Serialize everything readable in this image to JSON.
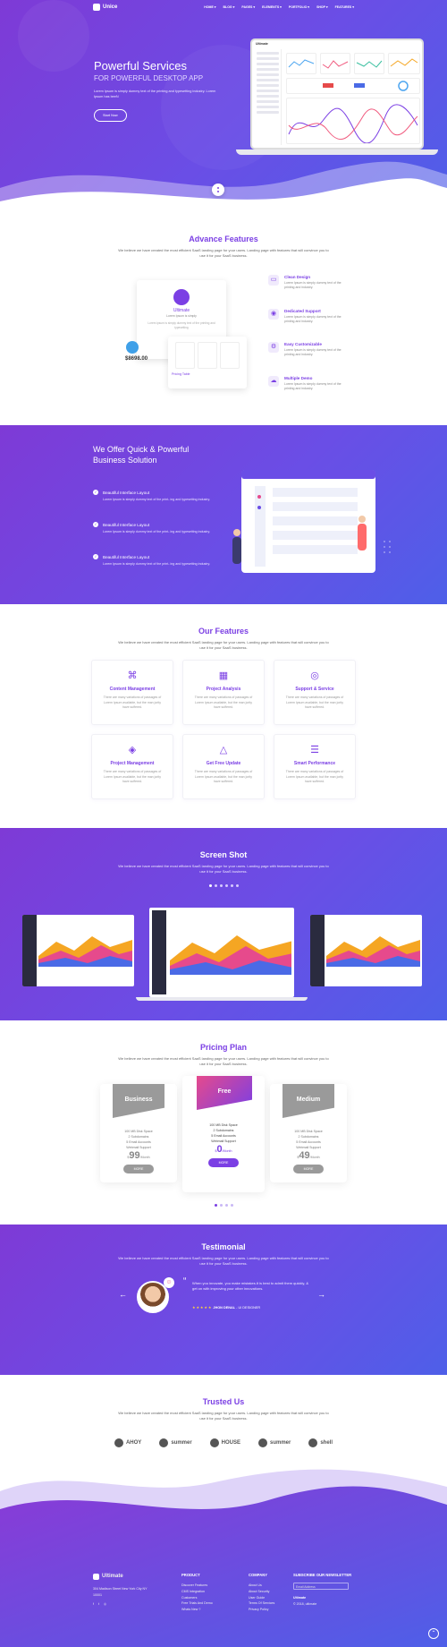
{
  "nav": {
    "brand": "Unice",
    "menu": [
      "HOME ▾",
      "BLOG ▾",
      "PAGES ▾",
      "ELEMENTS ▾",
      "PORTFOLIO ▾",
      "SHOP ▾",
      "FEATURES ▾"
    ]
  },
  "hero": {
    "title": "Powerful Services",
    "subtitle": "FOR POWERFUL DESKTOP APP",
    "text": "Lorem Ipsum is simply dummy text of the printing and typesetting industry. Lorem Ipsum has beeN",
    "button": "Start Now",
    "dash_brand": "Ultimate"
  },
  "advance": {
    "title": "Advance Features",
    "subtitle": "We believe we have created the most efficient SaaS landing page for your users. Landing page with features that will convince you to use it for your SaaS business.",
    "card_brand": "Ultimate",
    "card_tag": "Lorem Ipsum is simply",
    "card_desc": "Lorem ipsum is simply dummy text of the printing and typesetting",
    "stat": "$8698.00",
    "pricing_label": "Pricing Table",
    "items": [
      {
        "title": "Clean Design",
        "desc": "Lorem Ipsum is simply dummy text of the printing and industry."
      },
      {
        "title": "Dedicated Support",
        "desc": "Lorem Ipsum is simply dummy text of the printing and industry."
      },
      {
        "title": "Easy Customizable",
        "desc": "Lorem Ipsum is simply dummy text of the printing and industry."
      },
      {
        "title": "Multiple Demo",
        "desc": "Lorem Ipsum is simply dummy text of the printing and industry."
      }
    ]
  },
  "quick": {
    "title": "We Offer Quick & Powerful Business Solution",
    "items": [
      {
        "title": "Beautiful Interface Layout",
        "desc": "Lorem Ipsum is simply dummy text of the print- ing and typesetting industry."
      },
      {
        "title": "Beautiful Interface Layout",
        "desc": "Lorem Ipsum is simply dummy text of the print- ing and typesetting industry."
      },
      {
        "title": "Beautiful Interface Layout",
        "desc": "Lorem Ipsum is simply dummy text of the print- ing and typesetting industry."
      }
    ]
  },
  "features": {
    "title": "Our Features",
    "subtitle": "We believe we have created the most efficient SaaS landing page for your users. Landing page with features that will convince you to use it for your SaaS business.",
    "cards": [
      {
        "icon": "⌘",
        "title": "Content Management",
        "desc": "There are many variations of passages of Lorem Ipsum available, but the man jority have suffered."
      },
      {
        "icon": "▦",
        "title": "Project Analysis",
        "desc": "There are many variations of passages of Lorem Ipsum available, but the man jority have suffered."
      },
      {
        "icon": "◎",
        "title": "Support & Service",
        "desc": "There are many variations of passages of Lorem Ipsum available, but the man jority have suffered."
      },
      {
        "icon": "◈",
        "title": "Project Management",
        "desc": "There are many variations of passages of Lorem Ipsum available, but the man jority have suffered."
      },
      {
        "icon": "△",
        "title": "Get Free Update",
        "desc": "There are many variations of passages of Lorem Ipsum available, but the man jority have suffered."
      },
      {
        "icon": "☰",
        "title": "Smart Performance",
        "desc": "There are many variations of passages of Lorem Ipsum available, but the man jority have suffered."
      }
    ]
  },
  "shots": {
    "title": "Screen Shot",
    "subtitle": "We believe we have created the most efficient SaaS landing page for your users. Landing page with features that will convince you to use it for your SaaS business."
  },
  "pricing": {
    "title": "Pricing Plan",
    "subtitle": "We believe we have created the most efficient SaaS landing page for your users. Landing page with features that will convince you to use it for your SaaS business.",
    "plans": [
      {
        "name": "Business",
        "features": [
          "100 MB Disk Space",
          "2 Subdomains",
          "5 Email Accounts",
          "Webmail Support"
        ],
        "currency": "$",
        "price": "99",
        "period": "/Month",
        "button": "MORE"
      },
      {
        "name": "Free",
        "features": [
          "100 MB Disk Space",
          "2 Subdomains",
          "5 Email Accounts",
          "Webmail Support"
        ],
        "currency": "$",
        "price": "0",
        "period": "/Month",
        "button": "MORE"
      },
      {
        "name": "Medium",
        "features": [
          "100 MB Disk Space",
          "2 Subdomains",
          "5 Email Accounts",
          "Webmail Support"
        ],
        "currency": "$",
        "price": "49",
        "period": "/Month",
        "button": "MORE"
      }
    ]
  },
  "testimonial": {
    "title": "Testimonial",
    "subtitle": "We believe we have created the most efficient SaaS landing page for your users. Landing page with features that will convince you to use it for your SaaS business.",
    "quote": "When you innovate, you make mistakes.It is best to admit them quickly, & get on with improving your other innovations.",
    "author": "JHON DENAL",
    "role": "- UI DESIGNER",
    "stars": "★ ★ ★ ★ ★"
  },
  "trusted": {
    "title": "Trusted Us",
    "subtitle": "We believe we have created the most efficient SaaS landing page for your users. Landing page with features that will convince you to use it for your SaaS business.",
    "brands": [
      "AHOY",
      "summer",
      "HOUSE",
      "summer",
      "shell"
    ]
  },
  "footer": {
    "brand": "Ultimate",
    "address": "304 Madison Street New York City NY 10001",
    "product_title": "PRODUCT",
    "product_links": [
      "Discover Features",
      "CMS Integration",
      "Customers",
      "Free Trials And Demo",
      "Whats New ?"
    ],
    "company_title": "COMPANY",
    "company_links": [
      "About Us",
      "About Security",
      "User Guide",
      "Terms Of Services",
      "Privacy Policy"
    ],
    "newsletter_title": "SUBSCRIBE OUR NEWSLETTER",
    "newsletter_placeholder": "Email Address",
    "brand2": "Ultimate",
    "copyright": "© 2018, ultimate"
  },
  "colors": {
    "accent": "#7b3fe4",
    "gradient_start": "#7e3ad6",
    "gradient_end": "#4e5fe8"
  }
}
